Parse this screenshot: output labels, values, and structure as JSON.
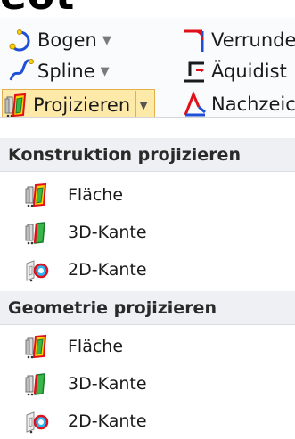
{
  "top_heading": "eot",
  "ribbon": {
    "bogen_label": "Bogen",
    "spline_label": "Spline",
    "projizieren_label": "Projizieren",
    "verrunden_label": "Verrunde",
    "aquidistanz_label": "Äquidist",
    "nachzeichnen_label": "Nachzeic",
    "dropdown_arrow": "▼"
  },
  "menu": {
    "sections": [
      {
        "title": "Konstruktion projizieren",
        "items": [
          {
            "label": "Fläche",
            "icon": "project-face-icon"
          },
          {
            "label": "3D-Kante",
            "icon": "project-3d-edge-icon"
          },
          {
            "label": "2D-Kante",
            "icon": "project-2d-edge-icon"
          }
        ]
      },
      {
        "title": "Geometrie projizieren",
        "items": [
          {
            "label": "Fläche",
            "icon": "project-face-icon"
          },
          {
            "label": "3D-Kante",
            "icon": "project-3d-edge-icon"
          },
          {
            "label": "2D-Kante",
            "icon": "project-2d-edge-icon"
          }
        ]
      }
    ]
  },
  "colors": {
    "ribbon_bg": "#fafbfc",
    "highlight_bg": "#fde9a8",
    "highlight_border": "#e3b04b",
    "header_bg": "#eef0f3",
    "accent_blue": "#1f4fd6",
    "accent_red": "#e0101a",
    "accent_green": "#39b54a"
  }
}
